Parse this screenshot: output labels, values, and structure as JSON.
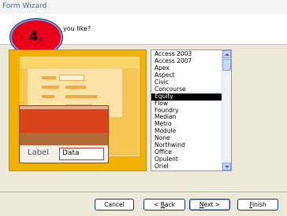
{
  "window": {
    "title_partial": "Form Wizard"
  },
  "header": {
    "question_partial": "you like?"
  },
  "step_badge": {
    "label": "4."
  },
  "preview": {
    "label_text": "Label",
    "data_text": "Data"
  },
  "styles_list": {
    "items": [
      "Access 2003",
      "Access 2007",
      "Apex",
      "Aspect",
      "Civic",
      "Concourse",
      "Equity",
      "Flow",
      "Foundry",
      "Median",
      "Metro",
      "Module",
      "None",
      "Northwind",
      "Office",
      "Opulent",
      "Oriel"
    ],
    "selected": "Equity"
  },
  "buttons": {
    "cancel": "Cancel",
    "back_key": "B",
    "back_rest": "ack",
    "next_key": "N",
    "next_rest": "ext >",
    "finish_key": "F",
    "finish_rest": "inish"
  }
}
